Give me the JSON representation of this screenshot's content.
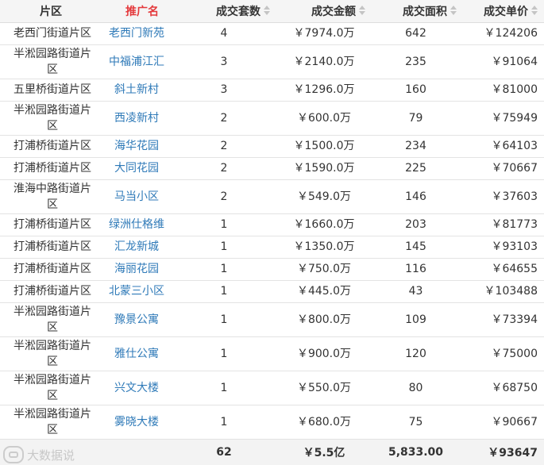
{
  "headers": {
    "district": "片区",
    "name": "推广名",
    "count": "成交套数",
    "amount": "成交金额",
    "area": "成交面积",
    "price": "成交单价"
  },
  "rows": [
    {
      "district": "老西门街道片区",
      "name": "老西门新苑",
      "count": "4",
      "amount": "￥7974.0万",
      "area": "642",
      "price": "￥124206"
    },
    {
      "district": "半淞园路街道片区",
      "name": "中福浦江汇",
      "count": "3",
      "amount": "￥2140.0万",
      "area": "235",
      "price": "￥91064"
    },
    {
      "district": "五里桥街道片区",
      "name": "斜土新村",
      "count": "3",
      "amount": "￥1296.0万",
      "area": "160",
      "price": "￥81000"
    },
    {
      "district": "半淞园路街道片区",
      "name": "西凌新村",
      "count": "2",
      "amount": "￥600.0万",
      "area": "79",
      "price": "￥75949"
    },
    {
      "district": "打浦桥街道片区",
      "name": "海华花园",
      "count": "2",
      "amount": "￥1500.0万",
      "area": "234",
      "price": "￥64103"
    },
    {
      "district": "打浦桥街道片区",
      "name": "大同花园",
      "count": "2",
      "amount": "￥1590.0万",
      "area": "225",
      "price": "￥70667"
    },
    {
      "district": "淮海中路街道片区",
      "name": "马当小区",
      "count": "2",
      "amount": "￥549.0万",
      "area": "146",
      "price": "￥37603"
    },
    {
      "district": "打浦桥街道片区",
      "name": "绿洲仕格维",
      "count": "1",
      "amount": "￥1660.0万",
      "area": "203",
      "price": "￥81773"
    },
    {
      "district": "打浦桥街道片区",
      "name": "汇龙新城",
      "count": "1",
      "amount": "￥1350.0万",
      "area": "145",
      "price": "￥93103"
    },
    {
      "district": "打浦桥街道片区",
      "name": "海丽花园",
      "count": "1",
      "amount": "￥750.0万",
      "area": "116",
      "price": "￥64655"
    },
    {
      "district": "打浦桥街道片区",
      "name": "北蒙三小区",
      "count": "1",
      "amount": "￥445.0万",
      "area": "43",
      "price": "￥103488"
    },
    {
      "district": "半淞园路街道片区",
      "name": "豫景公寓",
      "count": "1",
      "amount": "￥800.0万",
      "area": "109",
      "price": "￥73394"
    },
    {
      "district": "半淞园路街道片区",
      "name": "雅仕公寓",
      "count": "1",
      "amount": "￥900.0万",
      "area": "120",
      "price": "￥75000"
    },
    {
      "district": "半淞园路街道片区",
      "name": "兴文大楼",
      "count": "1",
      "amount": "￥550.0万",
      "area": "80",
      "price": "￥68750"
    },
    {
      "district": "半淞园路街道片区",
      "name": "雾晓大楼",
      "count": "1",
      "amount": "￥680.0万",
      "area": "75",
      "price": "￥90667"
    }
  ],
  "totals": {
    "count": "62",
    "amount": "￥5.5亿",
    "area": "5,833.00",
    "price": "￥93647"
  },
  "watermark": "大数据说"
}
